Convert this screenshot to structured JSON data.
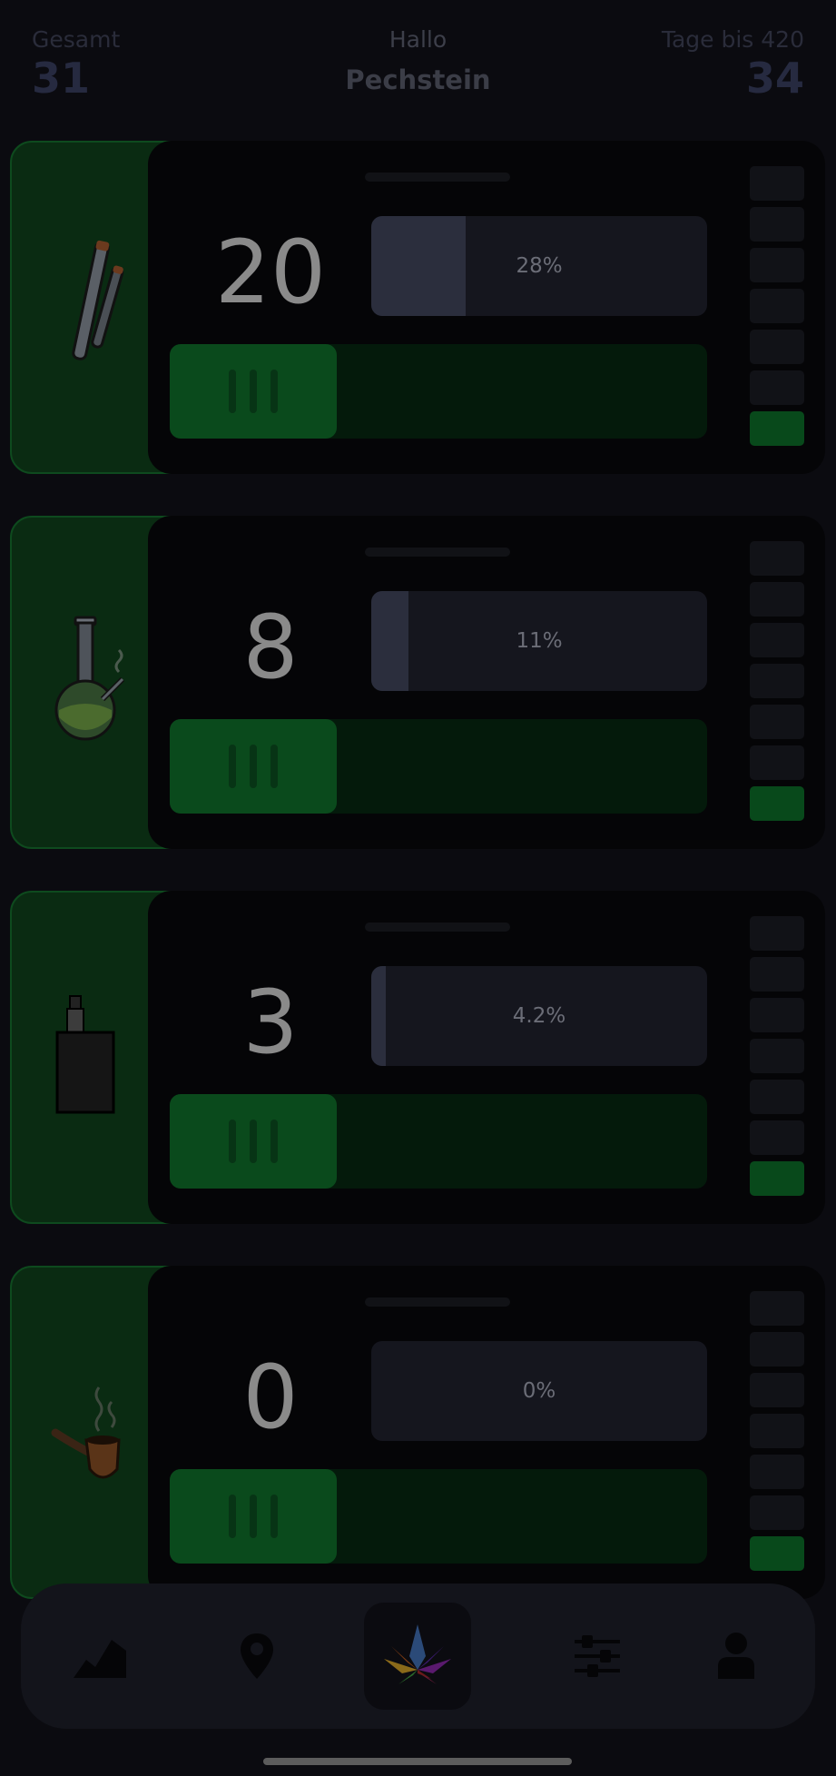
{
  "header": {
    "total_label": "Gesamt",
    "total_value": "31",
    "greeting": "Hallo",
    "name": "Pechstein",
    "days_label": "Tage bis 420",
    "days_value": "34"
  },
  "cards": [
    {
      "icon": "joint-icon",
      "count": "20",
      "percent_label": "28%",
      "percent": 0.28
    },
    {
      "icon": "bong-icon",
      "count": "8",
      "percent_label": "11%",
      "percent": 0.11
    },
    {
      "icon": "vape-icon",
      "count": "3",
      "percent_label": "4.2%",
      "percent": 0.042
    },
    {
      "icon": "pipe-icon",
      "count": "0",
      "percent_label": "0%",
      "percent": 0.0
    }
  ],
  "nav": {
    "items": [
      "stats-chart-icon",
      "map-pin-icon",
      "cannabis-leaf-icon",
      "sliders-icon",
      "user-icon"
    ]
  },
  "colors": {
    "background": "#0b0b10",
    "accent_green": "#0a4a1c",
    "card_dark": "#050507"
  }
}
